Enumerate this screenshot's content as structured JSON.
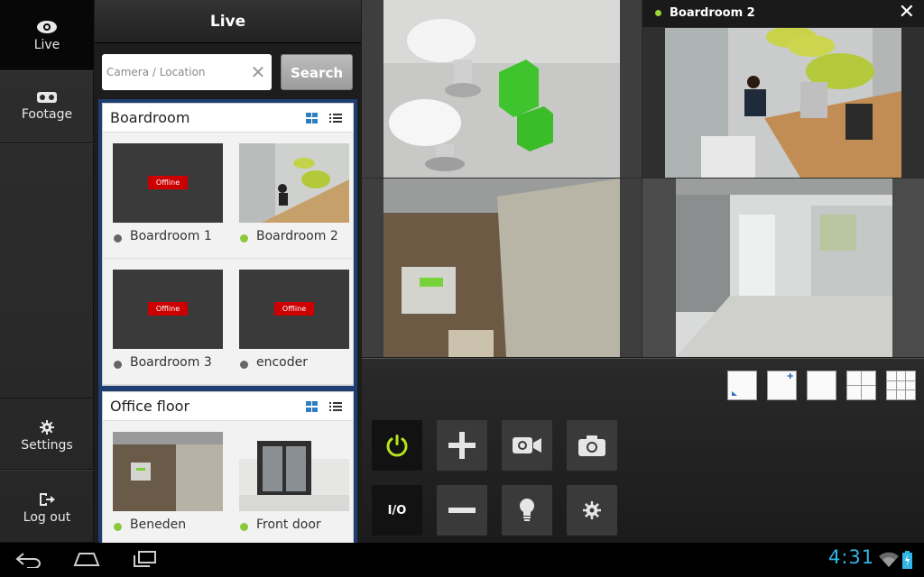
{
  "nav": {
    "live_label": "Live",
    "footage_label": "Footage",
    "settings_label": "Settings",
    "logout_label": "Log out"
  },
  "header": {
    "title": "Live"
  },
  "search": {
    "placeholder": "Camera / Location",
    "button_label": "Search"
  },
  "groups": [
    {
      "title": "Boardroom",
      "cameras": [
        {
          "name": "Boardroom 1",
          "status": "offline",
          "badge": "Offline"
        },
        {
          "name": "Boardroom 2",
          "status": "online"
        },
        {
          "name": "Boardroom 3",
          "status": "offline",
          "badge": "Offline"
        },
        {
          "name": "encoder",
          "status": "offline",
          "badge": "Offline"
        }
      ]
    },
    {
      "title": "Office floor",
      "cameras": [
        {
          "name": "Beneden",
          "status": "online"
        },
        {
          "name": "Front door",
          "status": "online"
        }
      ]
    }
  ],
  "selected_tile": {
    "name": "Boardroom 2"
  },
  "controls": {
    "io_label": "I/O"
  },
  "system": {
    "time": "4:31"
  },
  "colors": {
    "accent_green": "#8cc83c",
    "power_icon": "#b6e41e",
    "list_bg": "#1e3e72",
    "clock": "#33b5e5",
    "offline_badge": "#cc0000"
  }
}
